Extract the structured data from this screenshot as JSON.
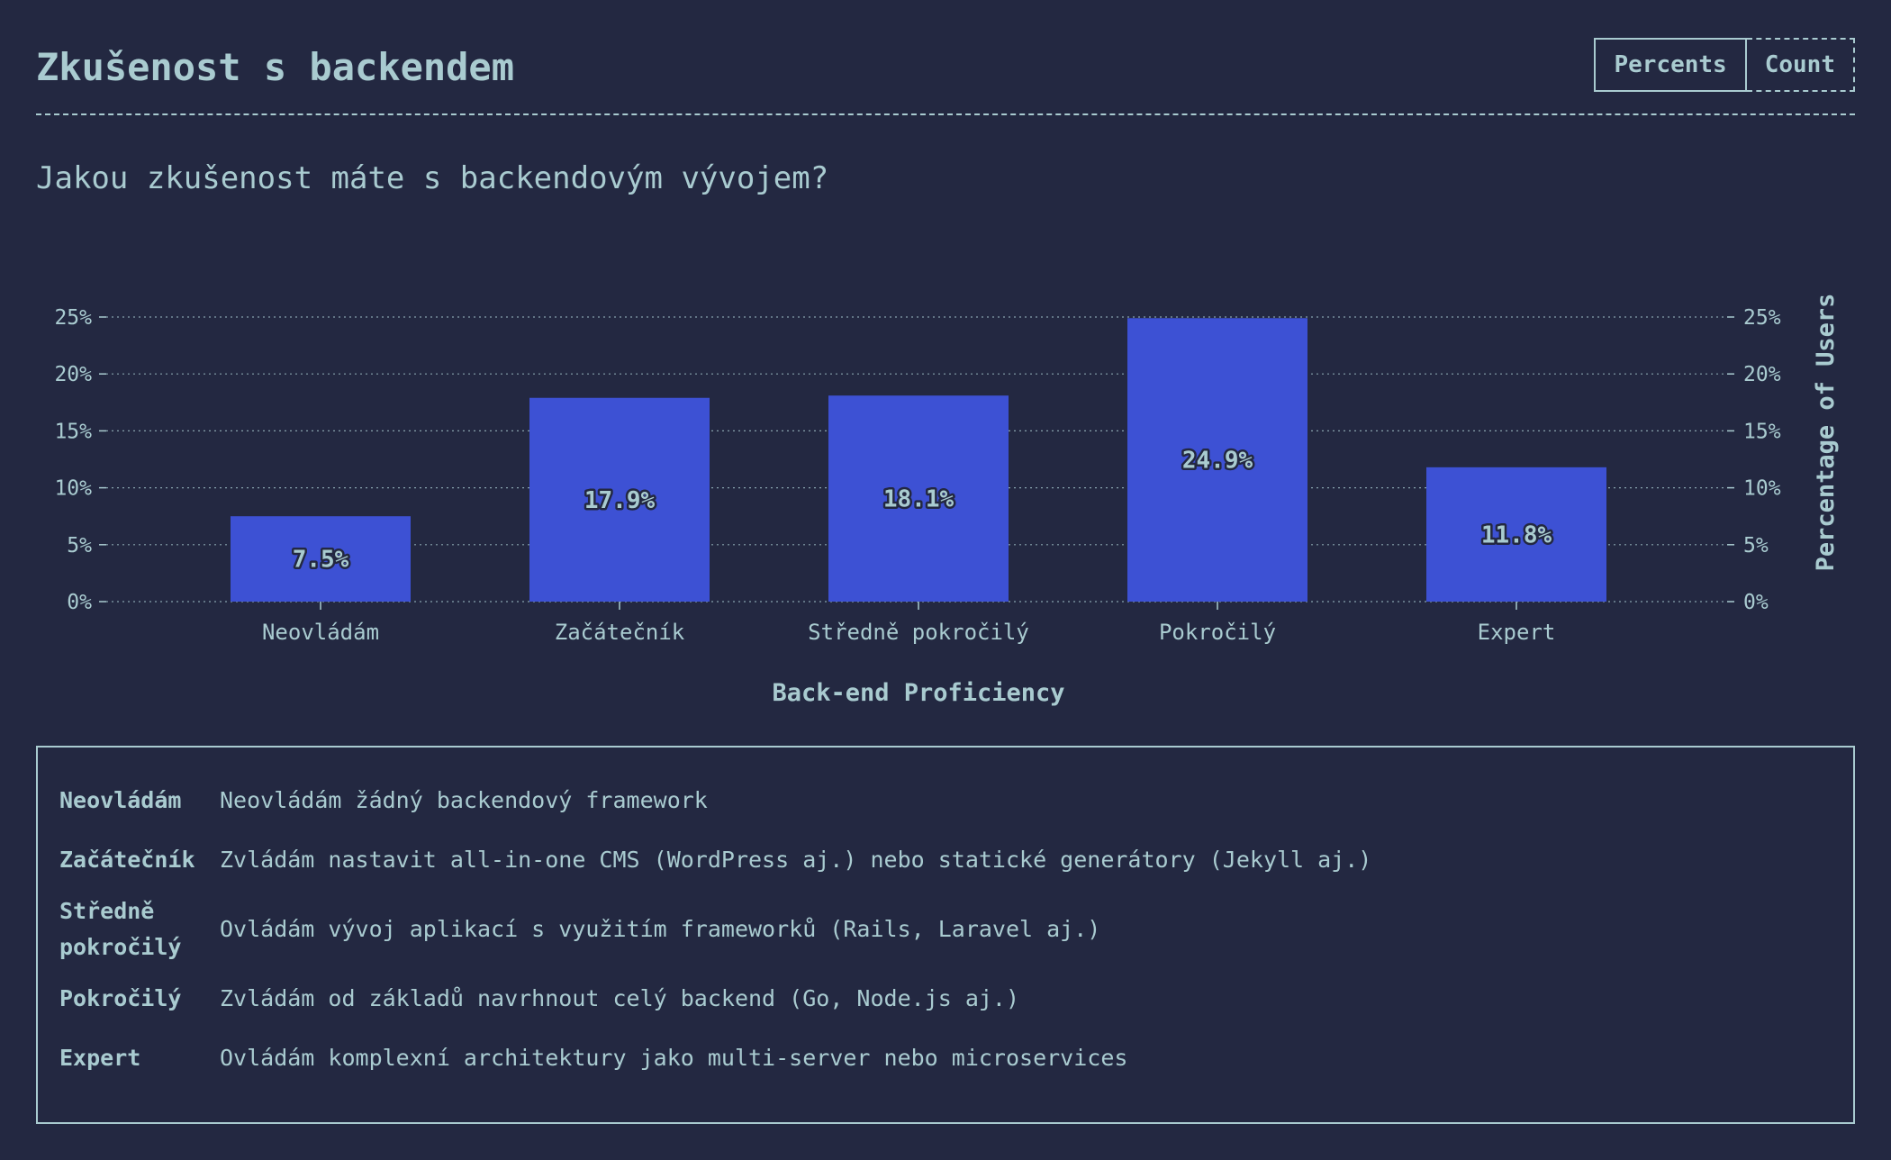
{
  "header": {
    "title": "Zkušenost s backendem",
    "toggle": {
      "percents_label": "Percents",
      "count_label": "Count",
      "active": "Percents"
    }
  },
  "question": "Jakou zkušenost máte s backendovým vývojem?",
  "chart_data": {
    "type": "bar",
    "categories": [
      "Neovládám",
      "Začátečník",
      "Středně pokročilý",
      "Pokročilý",
      "Expert"
    ],
    "values": [
      7.5,
      17.9,
      18.1,
      24.9,
      11.8
    ],
    "data_labels": [
      "7.5%",
      "17.9%",
      "18.1%",
      "24.9%",
      "11.8%"
    ],
    "xlabel": "Back-end Proficiency",
    "ylabel": "Percentage of Users",
    "ylim": [
      0,
      25
    ],
    "yticks": [
      0,
      5,
      10,
      15,
      20,
      25
    ],
    "ytick_labels": [
      "0%",
      "5%",
      "10%",
      "15%",
      "20%",
      "25%"
    ],
    "grid": true,
    "bar_color": "#3d51d4",
    "text_color": "#a9cbd0"
  },
  "legend": [
    {
      "term": "Neovládám",
      "desc": "Neovládám žádný backendový framework"
    },
    {
      "term": "Začátečník",
      "desc": "Zvládám nastavit all-in-one CMS (WordPress aj.) nebo statické generátory (Jekyll aj.)"
    },
    {
      "term": "Středně pokročilý",
      "desc": "Ovládám vývoj aplikací s využitím frameworků (Rails, Laravel aj.)"
    },
    {
      "term": "Pokročilý",
      "desc": "Zvládám od základů navrhnout celý backend (Go, Node.js aj.)"
    },
    {
      "term": "Expert",
      "desc": "Ovládám komplexní architektury jako multi-server nebo microservices"
    }
  ]
}
